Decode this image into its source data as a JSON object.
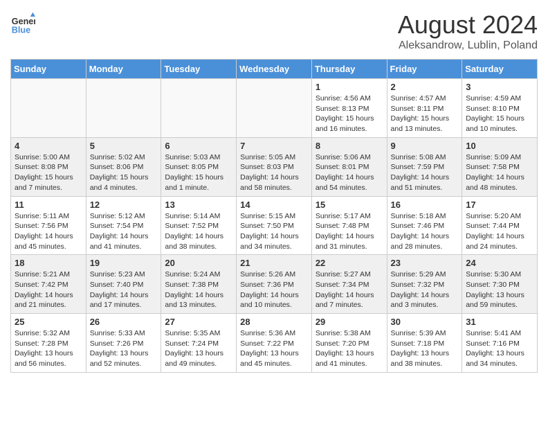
{
  "header": {
    "logo_line1": "General",
    "logo_line2": "Blue",
    "month_year": "August 2024",
    "location": "Aleksandrow, Lublin, Poland"
  },
  "weekdays": [
    "Sunday",
    "Monday",
    "Tuesday",
    "Wednesday",
    "Thursday",
    "Friday",
    "Saturday"
  ],
  "weeks": [
    [
      {
        "day": "",
        "info": ""
      },
      {
        "day": "",
        "info": ""
      },
      {
        "day": "",
        "info": ""
      },
      {
        "day": "",
        "info": ""
      },
      {
        "day": "1",
        "info": "Sunrise: 4:56 AM\nSunset: 8:13 PM\nDaylight: 15 hours\nand 16 minutes."
      },
      {
        "day": "2",
        "info": "Sunrise: 4:57 AM\nSunset: 8:11 PM\nDaylight: 15 hours\nand 13 minutes."
      },
      {
        "day": "3",
        "info": "Sunrise: 4:59 AM\nSunset: 8:10 PM\nDaylight: 15 hours\nand 10 minutes."
      }
    ],
    [
      {
        "day": "4",
        "info": "Sunrise: 5:00 AM\nSunset: 8:08 PM\nDaylight: 15 hours\nand 7 minutes."
      },
      {
        "day": "5",
        "info": "Sunrise: 5:02 AM\nSunset: 8:06 PM\nDaylight: 15 hours\nand 4 minutes."
      },
      {
        "day": "6",
        "info": "Sunrise: 5:03 AM\nSunset: 8:05 PM\nDaylight: 15 hours\nand 1 minute."
      },
      {
        "day": "7",
        "info": "Sunrise: 5:05 AM\nSunset: 8:03 PM\nDaylight: 14 hours\nand 58 minutes."
      },
      {
        "day": "8",
        "info": "Sunrise: 5:06 AM\nSunset: 8:01 PM\nDaylight: 14 hours\nand 54 minutes."
      },
      {
        "day": "9",
        "info": "Sunrise: 5:08 AM\nSunset: 7:59 PM\nDaylight: 14 hours\nand 51 minutes."
      },
      {
        "day": "10",
        "info": "Sunrise: 5:09 AM\nSunset: 7:58 PM\nDaylight: 14 hours\nand 48 minutes."
      }
    ],
    [
      {
        "day": "11",
        "info": "Sunrise: 5:11 AM\nSunset: 7:56 PM\nDaylight: 14 hours\nand 45 minutes."
      },
      {
        "day": "12",
        "info": "Sunrise: 5:12 AM\nSunset: 7:54 PM\nDaylight: 14 hours\nand 41 minutes."
      },
      {
        "day": "13",
        "info": "Sunrise: 5:14 AM\nSunset: 7:52 PM\nDaylight: 14 hours\nand 38 minutes."
      },
      {
        "day": "14",
        "info": "Sunrise: 5:15 AM\nSunset: 7:50 PM\nDaylight: 14 hours\nand 34 minutes."
      },
      {
        "day": "15",
        "info": "Sunrise: 5:17 AM\nSunset: 7:48 PM\nDaylight: 14 hours\nand 31 minutes."
      },
      {
        "day": "16",
        "info": "Sunrise: 5:18 AM\nSunset: 7:46 PM\nDaylight: 14 hours\nand 28 minutes."
      },
      {
        "day": "17",
        "info": "Sunrise: 5:20 AM\nSunset: 7:44 PM\nDaylight: 14 hours\nand 24 minutes."
      }
    ],
    [
      {
        "day": "18",
        "info": "Sunrise: 5:21 AM\nSunset: 7:42 PM\nDaylight: 14 hours\nand 21 minutes."
      },
      {
        "day": "19",
        "info": "Sunrise: 5:23 AM\nSunset: 7:40 PM\nDaylight: 14 hours\nand 17 minutes."
      },
      {
        "day": "20",
        "info": "Sunrise: 5:24 AM\nSunset: 7:38 PM\nDaylight: 14 hours\nand 13 minutes."
      },
      {
        "day": "21",
        "info": "Sunrise: 5:26 AM\nSunset: 7:36 PM\nDaylight: 14 hours\nand 10 minutes."
      },
      {
        "day": "22",
        "info": "Sunrise: 5:27 AM\nSunset: 7:34 PM\nDaylight: 14 hours\nand 7 minutes."
      },
      {
        "day": "23",
        "info": "Sunrise: 5:29 AM\nSunset: 7:32 PM\nDaylight: 14 hours\nand 3 minutes."
      },
      {
        "day": "24",
        "info": "Sunrise: 5:30 AM\nSunset: 7:30 PM\nDaylight: 13 hours\nand 59 minutes."
      }
    ],
    [
      {
        "day": "25",
        "info": "Sunrise: 5:32 AM\nSunset: 7:28 PM\nDaylight: 13 hours\nand 56 minutes."
      },
      {
        "day": "26",
        "info": "Sunrise: 5:33 AM\nSunset: 7:26 PM\nDaylight: 13 hours\nand 52 minutes."
      },
      {
        "day": "27",
        "info": "Sunrise: 5:35 AM\nSunset: 7:24 PM\nDaylight: 13 hours\nand 49 minutes."
      },
      {
        "day": "28",
        "info": "Sunrise: 5:36 AM\nSunset: 7:22 PM\nDaylight: 13 hours\nand 45 minutes."
      },
      {
        "day": "29",
        "info": "Sunrise: 5:38 AM\nSunset: 7:20 PM\nDaylight: 13 hours\nand 41 minutes."
      },
      {
        "day": "30",
        "info": "Sunrise: 5:39 AM\nSunset: 7:18 PM\nDaylight: 13 hours\nand 38 minutes."
      },
      {
        "day": "31",
        "info": "Sunrise: 5:41 AM\nSunset: 7:16 PM\nDaylight: 13 hours\nand 34 minutes."
      }
    ]
  ]
}
